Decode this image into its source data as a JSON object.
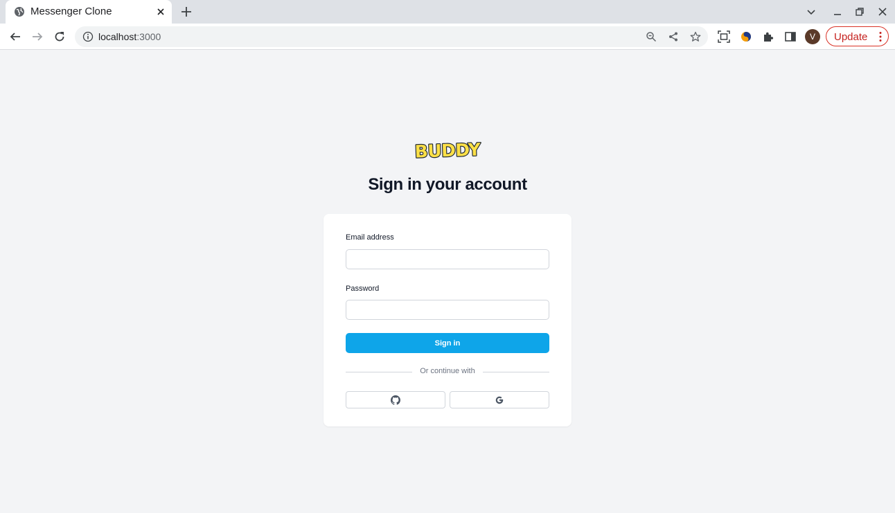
{
  "browser": {
    "tab_title": "Messenger Clone",
    "url_host": "localhost",
    "url_port": ":3000",
    "avatar_letter": "V",
    "update_label": "Update"
  },
  "page": {
    "logo_text": "BUDDY",
    "title": "Sign in your account",
    "email_label": "Email address",
    "email_value": "",
    "password_label": "Password",
    "password_value": "",
    "signin_label": "Sign in",
    "divider_text": "Or continue with",
    "social_buttons": [
      "github-icon",
      "google-icon"
    ]
  },
  "colors": {
    "primary": "#0ea5e9",
    "page_background": "#f3f4f6",
    "logo_fill": "#fde047"
  }
}
